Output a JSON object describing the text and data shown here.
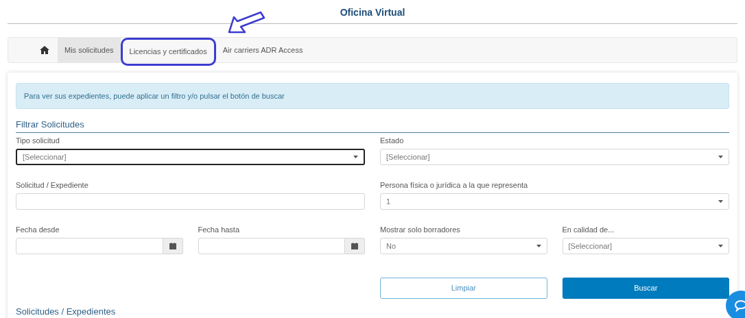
{
  "page_title": "Oficina Virtual",
  "nav": {
    "items": [
      {
        "kind": "home",
        "selected": false,
        "highlighted": false
      },
      {
        "kind": "tab",
        "label": "Mis solicitudes",
        "selected": true,
        "highlighted": false
      },
      {
        "kind": "tab",
        "label": "Licencias y certificados",
        "selected": false,
        "highlighted": true
      },
      {
        "kind": "tab",
        "label": "Air carriers ADR Access",
        "selected": false,
        "highlighted": false
      }
    ]
  },
  "alert": "Para ver sus expedientes, puede aplicar un filtro y/o pulsar el botón de buscar",
  "filter_section": {
    "title": "Filtrar Solicitudes",
    "rows": [
      [
        {
          "label": "Tipo solicitud",
          "kind": "select",
          "value": "[Seleccionar]",
          "focused": true
        },
        {
          "label": "Estado",
          "kind": "select",
          "value": "[Seleccionar]",
          "focused": false
        }
      ],
      [
        {
          "label": "Solicitud / Expediente",
          "kind": "text",
          "focused": false
        },
        {
          "label": "Persona física o jurídica a la que representa",
          "kind": "select",
          "value": "1",
          "focused": false
        }
      ],
      [
        {
          "label": "Fecha desde",
          "kind": "date",
          "focused": false
        },
        {
          "label": "Fecha hasta",
          "kind": "date",
          "focused": false
        },
        {
          "label": "Mostrar solo borradores",
          "kind": "select",
          "value": "No",
          "focused": false
        },
        {
          "label": "En calidad de...",
          "kind": "select",
          "value": "[Seleccionar]",
          "focused": false
        }
      ]
    ]
  },
  "buttons": [
    {
      "label": "Limpiar",
      "kind": "outline"
    },
    {
      "label": "Buscar",
      "kind": "primary"
    }
  ],
  "results_section": {
    "title": "Solicitudes / Expedientes"
  }
}
